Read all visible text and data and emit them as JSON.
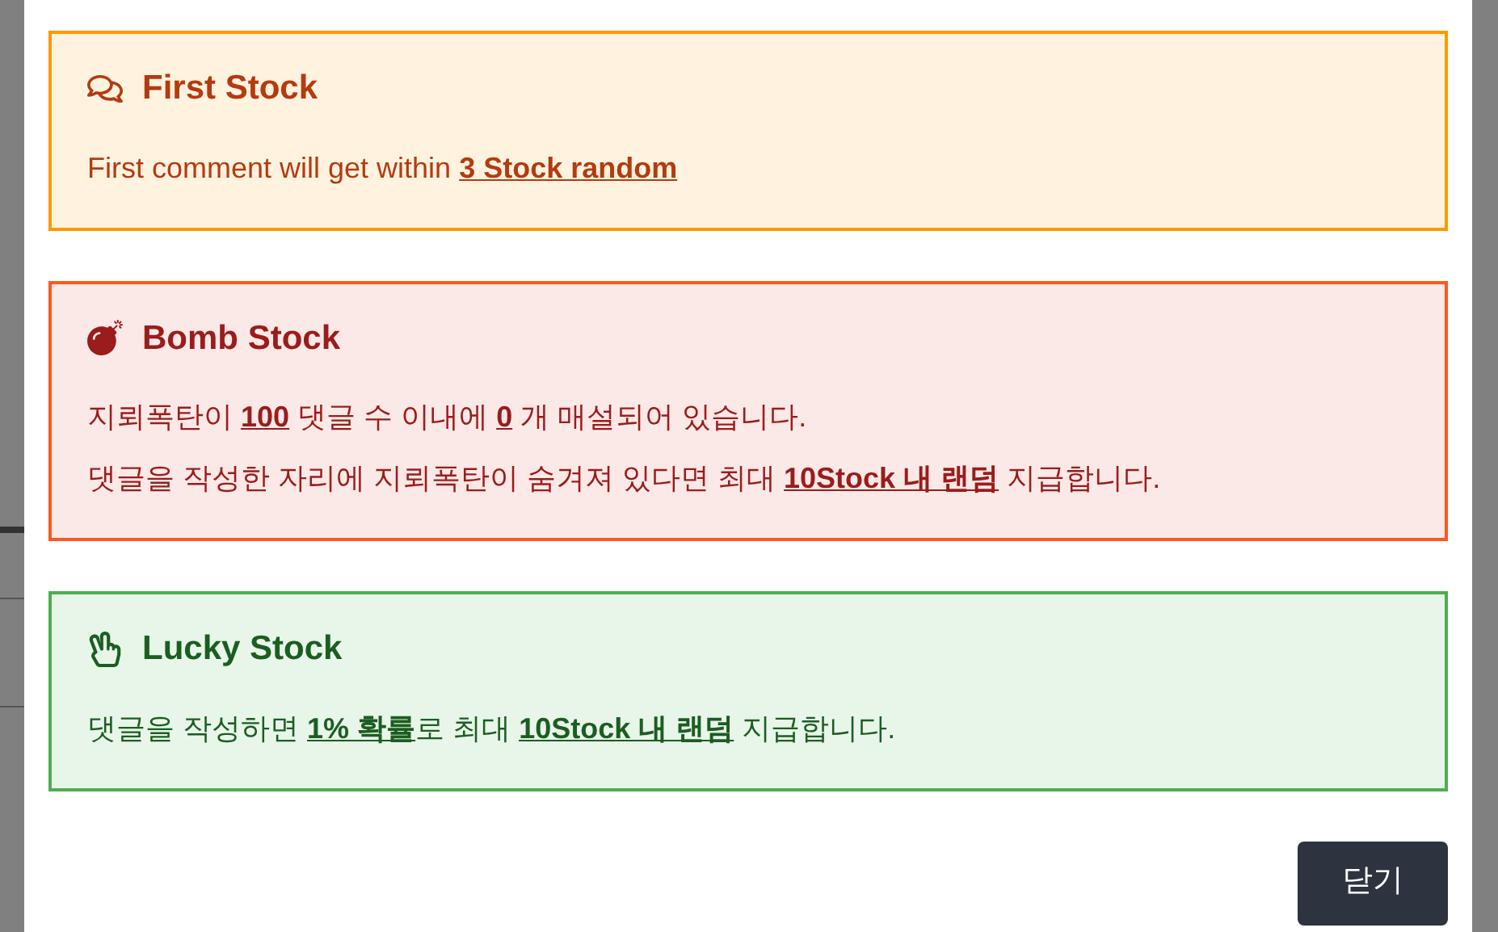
{
  "cards": [
    {
      "kind": "first",
      "title": "First Stock",
      "lines": [
        "First comment will get within **3 Stock random**"
      ]
    },
    {
      "kind": "bomb",
      "title": "Bomb Stock",
      "lines": [
        "지뢰폭탄이 **100** 댓글 수 이내에 **0** 개 매설되어 있습니다.",
        "댓글을 작성한 자리에 지뢰폭탄이 숨겨져 있다면 최대 **10Stock 내 랜덤** 지급합니다."
      ]
    },
    {
      "kind": "lucky",
      "title": "Lucky Stock",
      "lines": [
        "댓글을 작성하면 **1% 확률**로 최대 **10Stock 내 랜덤** 지급합니다."
      ]
    }
  ],
  "close_button": "닫기"
}
